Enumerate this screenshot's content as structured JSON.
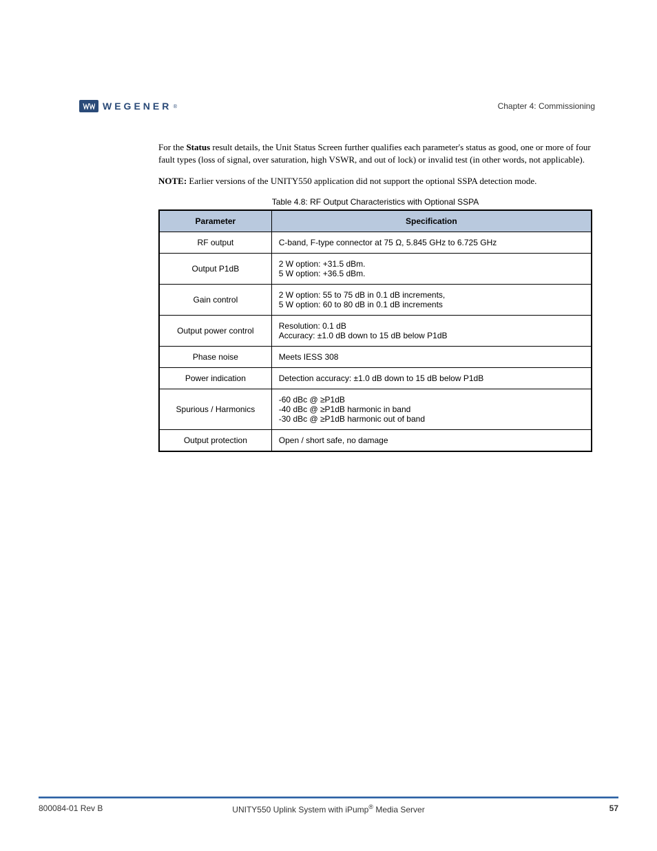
{
  "brand": {
    "name": "WEGENER"
  },
  "header": {
    "chapter_ref": "Chapter 4: Commissioning"
  },
  "content": {
    "para1_prefix": "For the ",
    "para1_status": "Status",
    "para1_rest": " result details, the Unit Status Screen further qualifies each parameter's status as good, one or more of four fault types (loss of signal, over saturation, high VSWR, and out of lock) or invalid test (in other words, not applicable).",
    "note_label": "NOTE: ",
    "note_rest": "Earlier versions of the UNITY550 application did not support the optional SSPA detection mode.",
    "table_caption": "Table 4.8: RF Output Characteristics with Optional SSPA"
  },
  "table": {
    "headers": [
      "Parameter",
      "Specification"
    ],
    "rows": [
      {
        "param": "RF output",
        "spec": "C-band, F-type connector at 75 Ω, 5.845 GHz to 6.725 GHz"
      },
      {
        "param": "Output P1dB",
        "spec_line1": "2 W option: +31.5 dBm.",
        "spec_line2": "5 W option: +36.5 dBm."
      },
      {
        "param": "Gain control",
        "spec_line1": "2 W option: 55 to 75 dB in 0.1 dB increments,",
        "spec_line2": "5 W option: 60 to 80 dB in 0.1 dB increments"
      },
      {
        "param": "Output power control",
        "spec_line1": "Resolution: 0.1 dB",
        "spec_line2": "Accuracy: ±1.0 dB down to 15 dB below P1dB"
      },
      {
        "param": "Phase noise",
        "spec": "Meets IESS 308"
      },
      {
        "param": "Power indication",
        "spec": "Detection accuracy: ±1.0 dB down to 15 dB below P1dB"
      },
      {
        "param": "Spurious / Harmonics",
        "spec_line1": "-60 dBc @ ≥P1dB",
        "spec_line2": "-40 dBc @ ≥P1dB harmonic in band",
        "spec_line3": "-30 dBc @ ≥P1dB harmonic out of band"
      },
      {
        "param": "Output protection",
        "spec": "Open / short safe, no damage"
      }
    ]
  },
  "footer": {
    "left": "800084-01 Rev B",
    "center_prefix": "UNITY550 Uplink System with iPump",
    "center_reg": "®",
    "center_suffix": " Media Server",
    "right": "57"
  }
}
